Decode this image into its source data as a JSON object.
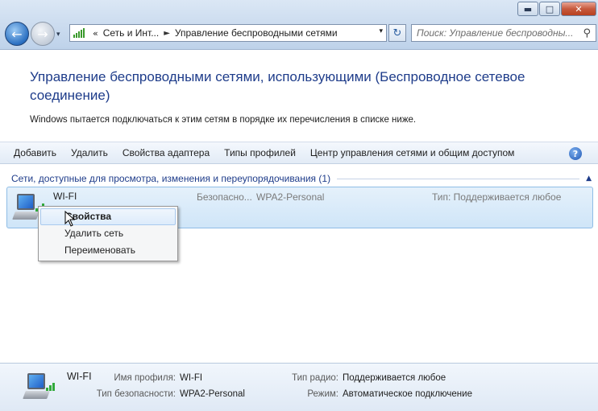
{
  "window": {
    "minimize_glyph": "▬",
    "maximize_glyph": "□",
    "close_glyph": "✕"
  },
  "nav": {
    "back_glyph": "←",
    "forward_glyph": "→",
    "history_glyph": "▾"
  },
  "address": {
    "chevron": "«",
    "crumb_1": "Сеть и Инт...",
    "separator": "►",
    "crumb_2": "Управление беспроводными сетями",
    "dropdown_glyph": "▾",
    "refresh_glyph": "↻"
  },
  "search": {
    "placeholder": "Поиск: Управление беспроводны...",
    "icon_glyph": "⚲"
  },
  "page": {
    "title": "Управление беспроводными сетями, использующими (Беспроводное сетевое соединение)",
    "description": "Windows пытается подключаться к этим сетям в порядке их перечисления в списке ниже."
  },
  "toolbar": {
    "items": [
      "Добавить",
      "Удалить",
      "Свойства адаптера",
      "Типы профилей",
      "Центр управления сетями и общим доступом"
    ],
    "help_glyph": "?"
  },
  "group": {
    "label": "Сети, доступные для просмотра, изменения и переупорядочивания (1)",
    "collapse_glyph": "▲"
  },
  "network": {
    "name": "WI-FI",
    "security_label": "Безопасно...",
    "security_value": "WPA2-Personal",
    "type": "Тип: Поддерживается любое"
  },
  "context_menu": {
    "items": [
      "Свойства",
      "Удалить сеть",
      "Переименовать"
    ],
    "selected": "Свойства"
  },
  "details": {
    "name": "WI-FI",
    "profile_label": "Имя профиля:",
    "profile_value": "WI-FI",
    "security_label": "Тип безопасности:",
    "security_value": "WPA2-Personal",
    "radio_label": "Тип радио:",
    "radio_value": "Поддерживается любое",
    "mode_label": "Режим:",
    "mode_value": "Автоматическое подключение"
  }
}
